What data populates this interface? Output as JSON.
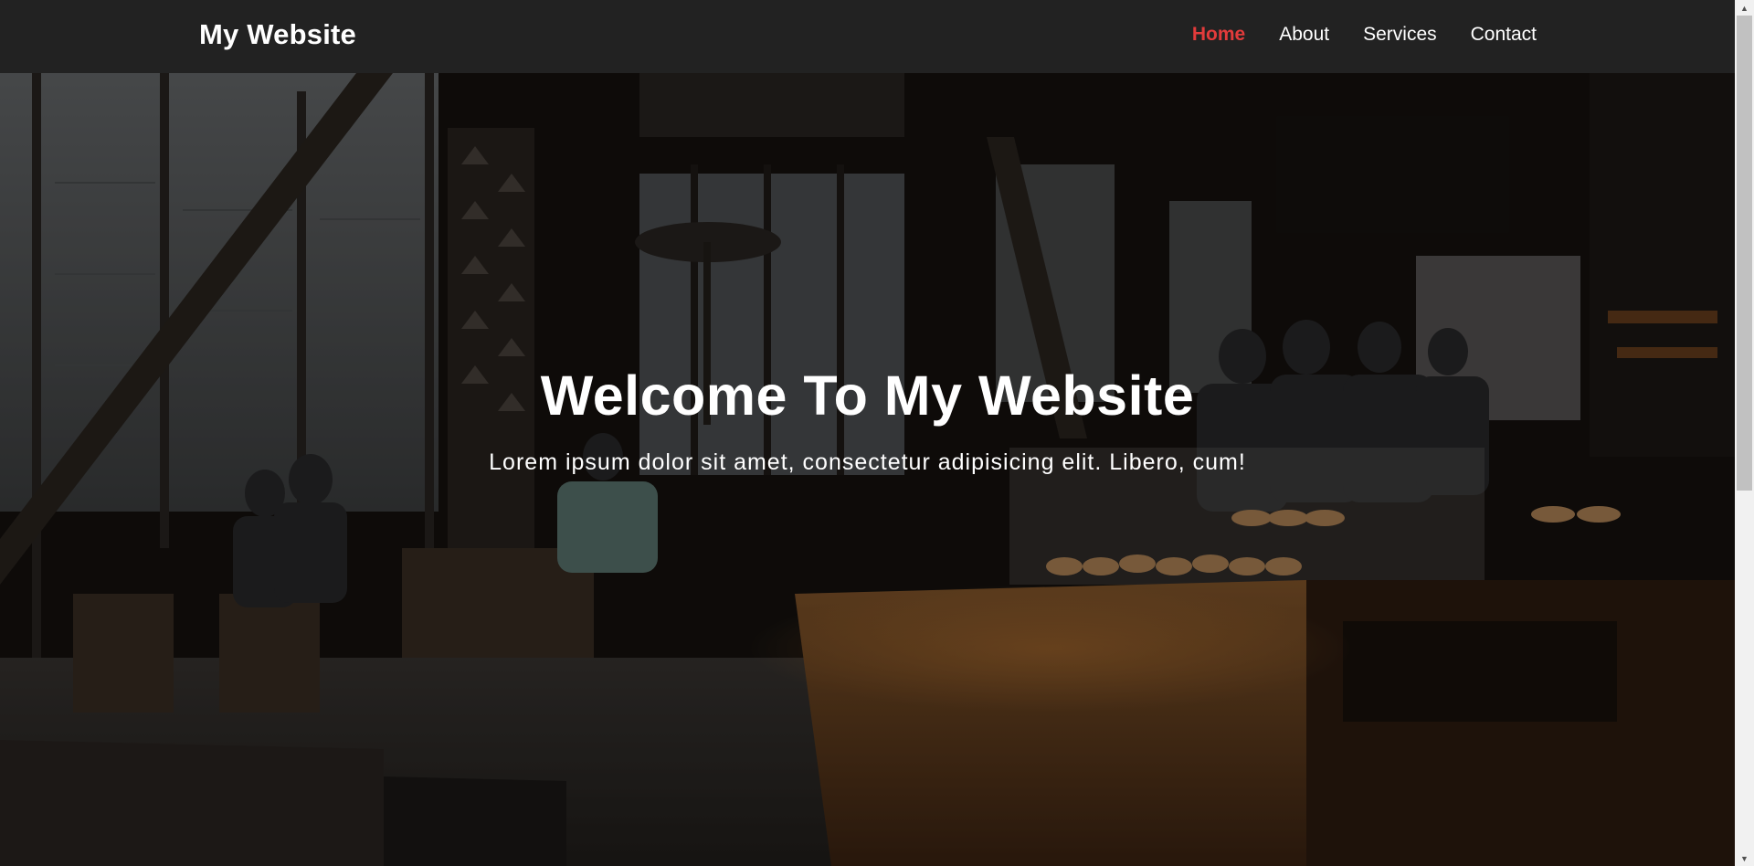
{
  "navbar": {
    "brand": "My Website",
    "links": [
      {
        "label": "Home",
        "active": true
      },
      {
        "label": "About",
        "active": false
      },
      {
        "label": "Services",
        "active": false
      },
      {
        "label": "Contact",
        "active": false
      }
    ]
  },
  "hero": {
    "title": "Welcome To My Website",
    "subtitle": "Lorem ipsum dolor sit amet, consectetur adipisicing elit. Libero, cum!"
  },
  "colors": {
    "navbar_bg": "#222222",
    "active_link": "#e23b3b",
    "text": "#ffffff"
  },
  "icons": {
    "scroll_up": "triangle-up-icon",
    "scroll_down": "triangle-down-icon"
  }
}
